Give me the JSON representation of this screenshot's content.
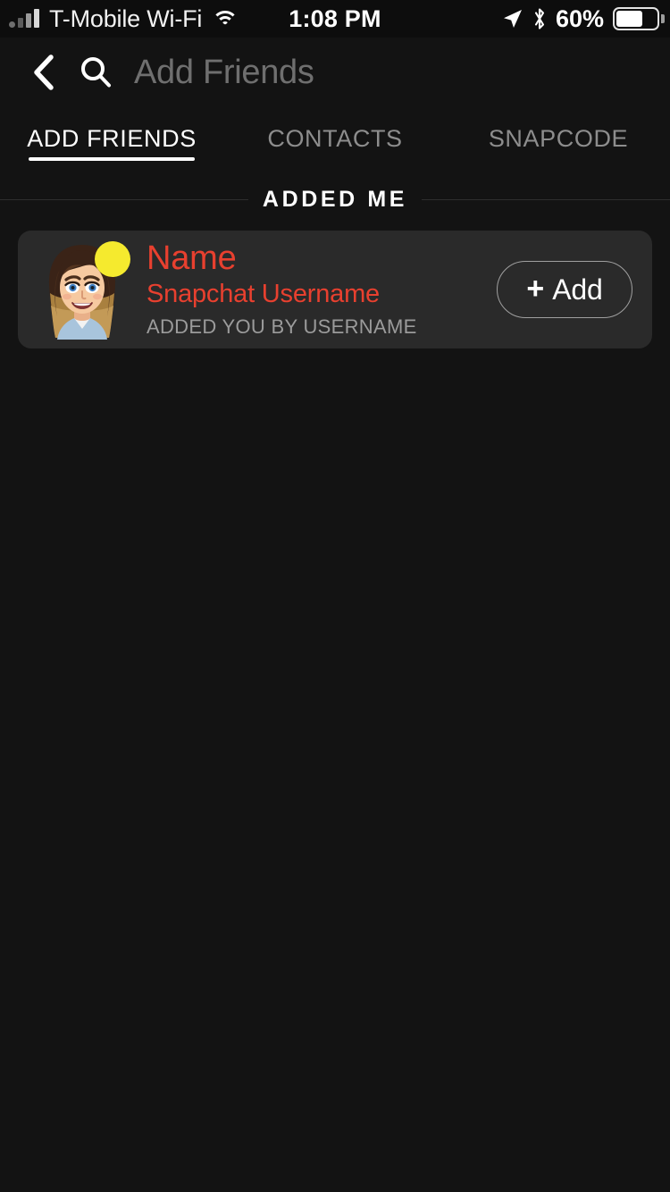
{
  "status_bar": {
    "carrier": "T-Mobile Wi-Fi",
    "time": "1:08 PM",
    "battery_percent": "60%",
    "battery_level": 60,
    "icons": {
      "signal": "signal-bars-icon",
      "wifi": "wifi-icon",
      "location": "location-arrow-icon",
      "bluetooth": "bluetooth-icon",
      "battery": "battery-icon"
    }
  },
  "header": {
    "back_icon": "chevron-left-icon",
    "search_icon": "search-icon",
    "search_value": "",
    "search_placeholder": "Add Friends"
  },
  "tabs": [
    {
      "label": "ADD FRIENDS",
      "active": true
    },
    {
      "label": "CONTACTS",
      "active": false
    },
    {
      "label": "SNAPCODE",
      "active": false
    }
  ],
  "section": {
    "title": "ADDED ME"
  },
  "friends": [
    {
      "name": "Name",
      "username": "Snapchat Username",
      "meta": "ADDED YOU BY USERNAME",
      "avatar": "bitmoji-avatar",
      "badge": "yellow-dot-badge",
      "action_plus": "+",
      "action_label": "Add"
    }
  ],
  "colors": {
    "page_background": "#131313",
    "card_background": "#2a2a2a",
    "accent_red": "#e8402f",
    "badge_yellow": "#f5ea2e",
    "muted_text": "#9b9b9b",
    "tab_inactive": "#8d8d8d",
    "placeholder": "#6f6f6f"
  }
}
